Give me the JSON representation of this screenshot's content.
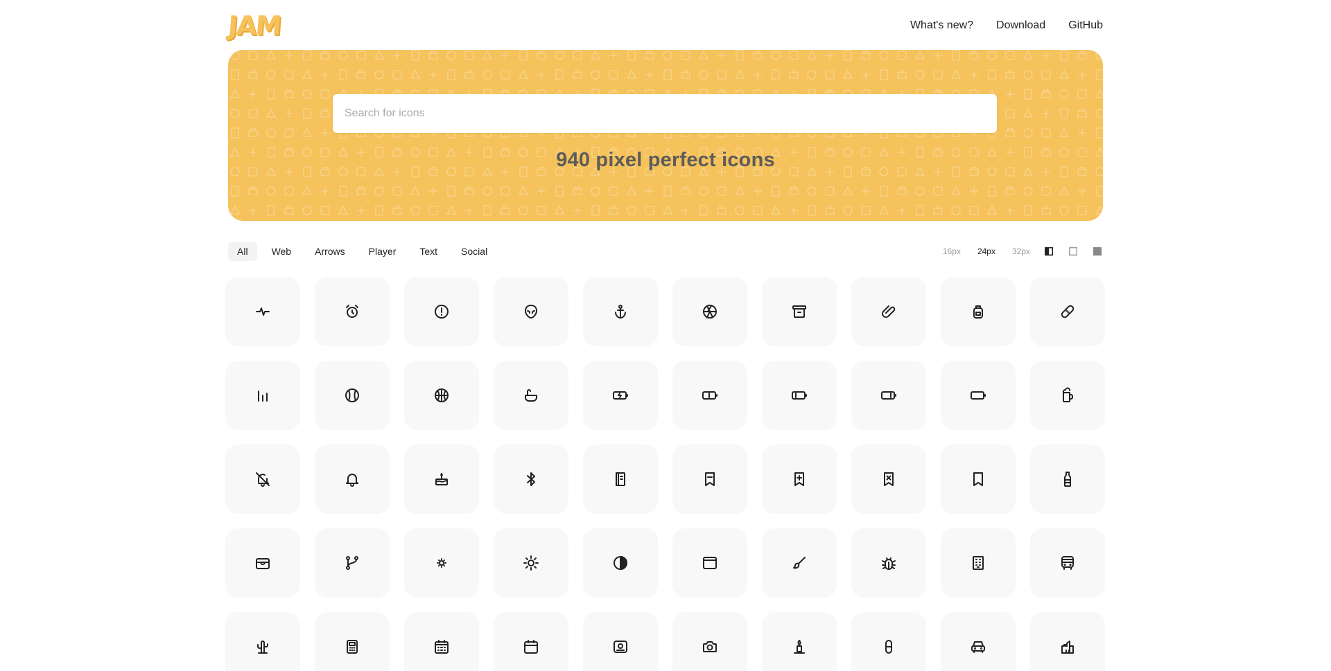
{
  "header": {
    "logo": "JAM",
    "nav": [
      "What's new?",
      "Download",
      "GitHub"
    ]
  },
  "hero": {
    "search_placeholder": "Search for icons",
    "title": "940 pixel perfect icons",
    "background": "#f5c25b"
  },
  "filters": {
    "tabs": [
      "All",
      "Web",
      "Arrows",
      "Player",
      "Text",
      "Social"
    ],
    "active_tab": "All",
    "sizes": [
      "16px",
      "24px",
      "32px"
    ],
    "active_size": "24px",
    "modes": [
      "half-fill-mode-icon",
      "outline-mode-icon",
      "fill-mode-icon"
    ]
  },
  "icons": [
    "activity-icon",
    "alarm-clock-icon",
    "alert-icon",
    "alien-icon",
    "anchor-icon",
    "aperture-icon",
    "archive-icon",
    "attachment-icon",
    "backpack-icon",
    "bandage-icon",
    "bar-chart-icon",
    "baseball-icon",
    "basketball-icon",
    "bath-icon",
    "battery-charging-icon",
    "battery-half-icon",
    "battery-quarter-icon",
    "battery-three-quarter-icon",
    "battery-empty-icon",
    "beer-icon",
    "bell-off-icon",
    "bell-icon",
    "birthday-cake-icon",
    "bluetooth-icon",
    "book-icon",
    "bookmark-minus-icon",
    "bookmark-plus-icon",
    "bookmark-remove-icon",
    "bookmark-icon",
    "bottle-icon",
    "box-icon",
    "branch-icon",
    "brightness-down-icon",
    "brightness-up-icon",
    "brightness-icon",
    "browser-icon",
    "brush-icon",
    "bug-icon",
    "building-icon",
    "bus-icon",
    "cactus-icon",
    "calculator-icon",
    "calendar-alt-icon",
    "calendar-icon",
    "camcorder-icon",
    "camera-icon",
    "candle-icon",
    "capsule-icon",
    "car-icon",
    "castle-icon"
  ]
}
